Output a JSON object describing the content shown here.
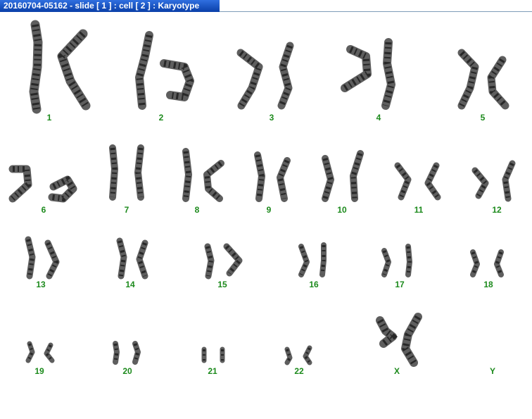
{
  "window": {
    "title": "20160704-05162 - slide [ 1 ] : cell [ 2 ] : Karyotype"
  },
  "colors": {
    "title_bar": "#0a3fa8",
    "label": "#1c8a1c",
    "chromosome": "#3a3a3a",
    "band": "#111111"
  },
  "karyotype": {
    "chromosomes": [
      {
        "label": "1",
        "icon": "chromosome-pair-icon"
      },
      {
        "label": "2",
        "icon": "chromosome-pair-icon"
      },
      {
        "label": "3",
        "icon": "chromosome-pair-icon"
      },
      {
        "label": "4",
        "icon": "chromosome-pair-icon"
      },
      {
        "label": "5",
        "icon": "chromosome-pair-icon"
      },
      {
        "label": "6",
        "icon": "chromosome-pair-icon"
      },
      {
        "label": "7",
        "icon": "chromosome-pair-icon"
      },
      {
        "label": "8",
        "icon": "chromosome-pair-icon"
      },
      {
        "label": "9",
        "icon": "chromosome-pair-icon"
      },
      {
        "label": "10",
        "icon": "chromosome-pair-icon"
      },
      {
        "label": "11",
        "icon": "chromosome-pair-icon"
      },
      {
        "label": "12",
        "icon": "chromosome-pair-icon"
      },
      {
        "label": "13",
        "icon": "chromosome-pair-icon"
      },
      {
        "label": "14",
        "icon": "chromosome-pair-icon"
      },
      {
        "label": "15",
        "icon": "chromosome-pair-icon"
      },
      {
        "label": "16",
        "icon": "chromosome-pair-icon"
      },
      {
        "label": "17",
        "icon": "chromosome-pair-icon"
      },
      {
        "label": "18",
        "icon": "chromosome-pair-icon"
      },
      {
        "label": "19",
        "icon": "chromosome-pair-icon"
      },
      {
        "label": "20",
        "icon": "chromosome-pair-icon"
      },
      {
        "label": "21",
        "icon": "chromosome-pair-icon"
      },
      {
        "label": "22",
        "icon": "chromosome-pair-icon"
      },
      {
        "label": "X",
        "icon": "chromosome-pair-icon"
      },
      {
        "label": "Y",
        "icon": "empty-slot"
      }
    ]
  }
}
